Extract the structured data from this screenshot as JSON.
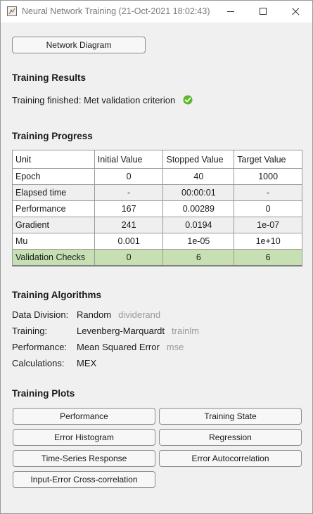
{
  "window": {
    "title": "Neural Network Training (21-Oct-2021 18:02:43)"
  },
  "buttons": {
    "network_diagram": "Network Diagram"
  },
  "results": {
    "heading": "Training Results",
    "status": "Training finished: Met validation criterion",
    "status_color": "#5cb82e"
  },
  "progress": {
    "heading": "Training Progress",
    "columns": [
      "Unit",
      "Initial Value",
      "Stopped Value",
      "Target Value"
    ],
    "rows": [
      [
        "Epoch",
        "0",
        "40",
        "1000"
      ],
      [
        "Elapsed time",
        "-",
        "00:00:01",
        "-"
      ],
      [
        "Performance",
        "167",
        "0.00289",
        "0"
      ],
      [
        "Gradient",
        "241",
        "0.0194",
        "1e-07"
      ],
      [
        "Mu",
        "0.001",
        "1e-05",
        "1e+10"
      ],
      [
        "Validation Checks",
        "0",
        "6",
        "6"
      ]
    ],
    "highlight_color": "#c6e0b4"
  },
  "algorithms": {
    "heading": "Training Algorithms",
    "items": [
      {
        "label": "Data Division:",
        "value": "Random",
        "fn": "dividerand"
      },
      {
        "label": "Training:",
        "value": "Levenberg-Marquardt",
        "fn": "trainlm"
      },
      {
        "label": "Performance:",
        "value": "Mean Squared Error",
        "fn": "mse"
      },
      {
        "label": "Calculations:",
        "value": "MEX",
        "fn": ""
      }
    ]
  },
  "plots": {
    "heading": "Training Plots",
    "buttons": [
      "Performance",
      "Training State",
      "Error Histogram",
      "Regression",
      "Time-Series Response",
      "Error Autocorrelation",
      "Input-Error Cross-correlation"
    ]
  }
}
